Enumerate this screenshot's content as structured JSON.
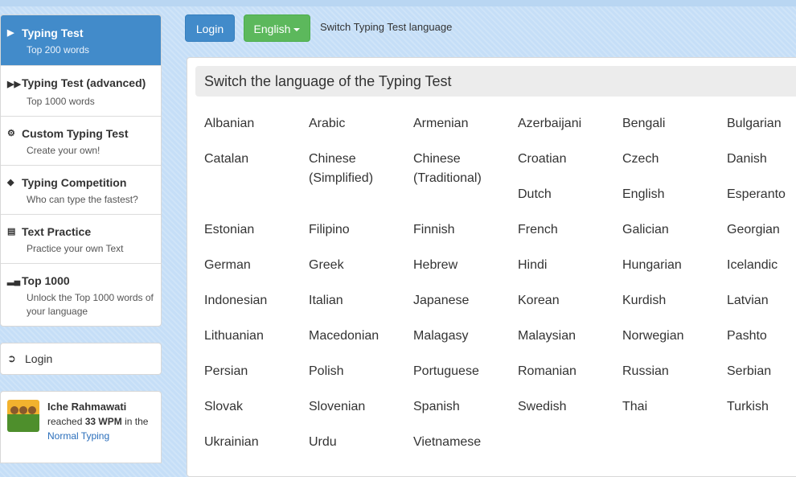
{
  "sidebar": {
    "items": [
      {
        "title": "Typing Test",
        "sub": "Top 200 words",
        "icon": "play-icon"
      },
      {
        "title": "Typing Test (advanced)",
        "sub": "Top 1000 words",
        "icon": "fast-forward-icon"
      },
      {
        "title": "Custom Typing Test",
        "sub": "Create your own!",
        "icon": "cogs-icon"
      },
      {
        "title": "Typing Competition",
        "sub": "Who can type the fastest?",
        "icon": "trophy-icon"
      },
      {
        "title": "Text Practice",
        "sub": "Practice your own Text",
        "icon": "document-icon"
      },
      {
        "title": "Top 1000",
        "sub": "Unlock the Top 1000 words of your language",
        "icon": "signal-bars-icon"
      }
    ],
    "login_label": "Login",
    "feed": {
      "name": "Iche Rahmawati",
      "reached": "reached",
      "wpm": "33 WPM",
      "in_the": "in the",
      "link": "Normal Typing"
    }
  },
  "topbar": {
    "login_label": "Login",
    "language_label": "English",
    "switch_text": "Switch Typing Test language"
  },
  "panel": {
    "heading": "Switch the language of the Typing Test",
    "languages": [
      "Albanian",
      "Arabic",
      "Armenian",
      "Azerbaijani",
      "Bengali",
      "Bulgarian",
      "Catalan",
      "Chinese (Simplified)",
      "Chinese (Traditional)",
      "Croatian",
      "Czech",
      "Danish",
      "Dutch",
      "English",
      "Esperanto",
      "Estonian",
      "Filipino",
      "Finnish",
      "French",
      "Galician",
      "Georgian",
      "German",
      "Greek",
      "Hebrew",
      "Hindi",
      "Hungarian",
      "Icelandic",
      "Indonesian",
      "Italian",
      "Japanese",
      "Korean",
      "Kurdish",
      "Latvian",
      "Lithuanian",
      "Macedonian",
      "Malagasy",
      "Malaysian",
      "Norwegian",
      "Pashto",
      "Persian",
      "Polish",
      "Portuguese",
      "Romanian",
      "Russian",
      "Serbian",
      "Slovak",
      "Slovenian",
      "Spanish",
      "Swedish",
      "Thai",
      "Turkish",
      "Ukrainian",
      "Urdu",
      "Vietnamese"
    ]
  },
  "colors": {
    "primary": "#428bca",
    "success": "#5cb85c",
    "link": "#2a6ebb"
  }
}
